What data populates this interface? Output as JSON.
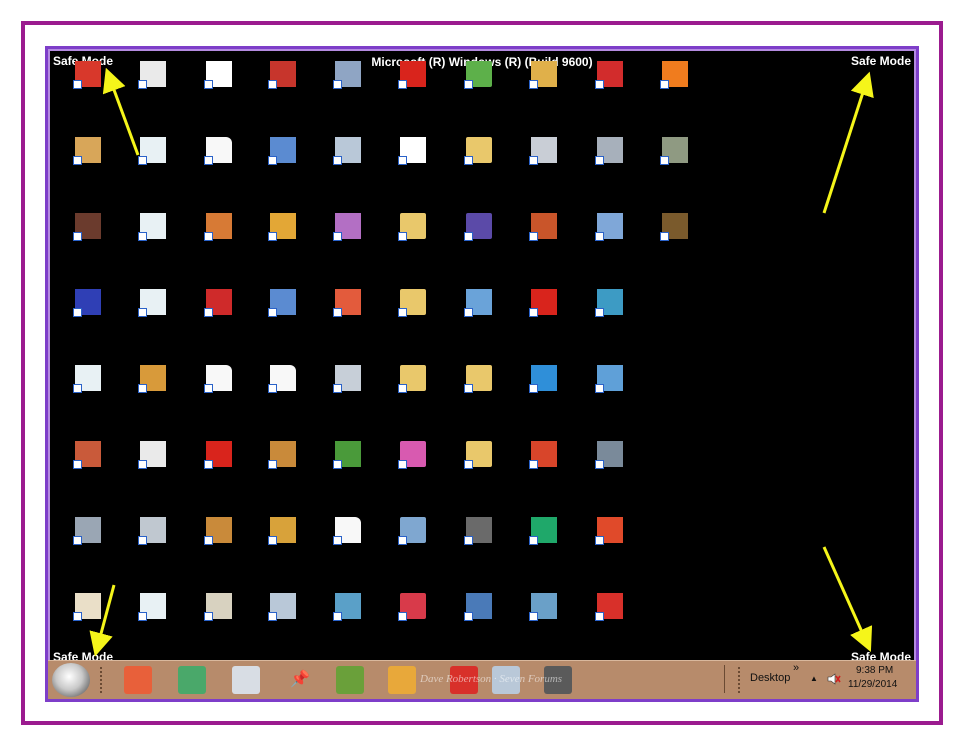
{
  "window_title": "Microsoft (R) Windows (R) (Build 9600)",
  "safe_mode_label": "Safe Mode",
  "colors": {
    "frame": "#9b1b8f",
    "screen_border": "#7e3ec9",
    "desktop": "#000000",
    "taskbar": "#b78b6b",
    "arrow": "#f5f51a"
  },
  "desktop_icons": [
    {
      "c": 0,
      "r": 0,
      "color": "#d8382b",
      "icon": "gift-icon"
    },
    {
      "c": 1,
      "r": 0,
      "color": "#eaeaea",
      "icon": "window-icon"
    },
    {
      "c": 2,
      "r": 0,
      "color": "#ffffff",
      "icon": "cursor-icon"
    },
    {
      "c": 3,
      "r": 0,
      "color": "#c7352c",
      "icon": "home-icon"
    },
    {
      "c": 4,
      "r": 0,
      "color": "#8fa5c4",
      "icon": "settings-icon"
    },
    {
      "c": 5,
      "r": 0,
      "color": "#d9241c",
      "icon": "opera-icon"
    },
    {
      "c": 6,
      "r": 0,
      "color": "#5db04a",
      "icon": "folder-icon"
    },
    {
      "c": 7,
      "r": 0,
      "color": "#e0b04a",
      "icon": "app-icon"
    },
    {
      "c": 8,
      "r": 0,
      "color": "#d22c2c",
      "icon": "app-icon"
    },
    {
      "c": 9,
      "r": 0,
      "color": "#f07c1e",
      "icon": "avast-icon"
    },
    {
      "c": 0,
      "r": 1,
      "color": "#d8a659",
      "icon": "counter-icon"
    },
    {
      "c": 1,
      "r": 1,
      "color": "#e8f1f4",
      "icon": "script-icon"
    },
    {
      "c": 2,
      "r": 1,
      "color": "#f8f8f8",
      "icon": "document-icon"
    },
    {
      "c": 3,
      "r": 1,
      "color": "#5b8bd1",
      "icon": "clock-icon"
    },
    {
      "c": 4,
      "r": 1,
      "color": "#b9c8d8",
      "icon": "settings-icon"
    },
    {
      "c": 5,
      "r": 1,
      "color": "#ffffff",
      "icon": "filezilla-icon"
    },
    {
      "c": 6,
      "r": 1,
      "color": "#e9c86b",
      "icon": "folder-icon"
    },
    {
      "c": 7,
      "r": 1,
      "color": "#c9ced6",
      "icon": "app-icon"
    },
    {
      "c": 8,
      "r": 1,
      "color": "#a7b0bb",
      "icon": "panda-icon"
    },
    {
      "c": 9,
      "r": 1,
      "color": "#8f9a82",
      "icon": "drive-icon"
    },
    {
      "c": 0,
      "r": 2,
      "color": "#6b3b2d",
      "icon": "photo-icon"
    },
    {
      "c": 1,
      "r": 2,
      "color": "#e8f1f4",
      "icon": "script-icon"
    },
    {
      "c": 2,
      "r": 2,
      "color": "#d77a35",
      "icon": "app-icon"
    },
    {
      "c": 3,
      "r": 2,
      "color": "#e3a736",
      "icon": "alarm-icon"
    },
    {
      "c": 4,
      "r": 2,
      "color": "#b36fc4",
      "icon": "app-icon"
    },
    {
      "c": 5,
      "r": 2,
      "color": "#e9c86b",
      "icon": "folder-icon"
    },
    {
      "c": 6,
      "r": 2,
      "color": "#5b4aa8",
      "icon": "folder-icon"
    },
    {
      "c": 7,
      "r": 2,
      "color": "#c9552a",
      "icon": "picture-icon"
    },
    {
      "c": 8,
      "r": 2,
      "color": "#7fa7d8",
      "icon": "app-icon"
    },
    {
      "c": 9,
      "r": 2,
      "color": "#7a5a2c",
      "icon": "toolbox-icon"
    },
    {
      "c": 0,
      "r": 3,
      "color": "#2f3fb5",
      "icon": "app-icon"
    },
    {
      "c": 1,
      "r": 3,
      "color": "#e8f1f4",
      "icon": "script-icon"
    },
    {
      "c": 2,
      "r": 3,
      "color": "#cf2a2a",
      "icon": "opera-box-icon"
    },
    {
      "c": 3,
      "r": 3,
      "color": "#5b8bd1",
      "icon": "clock-icon"
    },
    {
      "c": 4,
      "r": 3,
      "color": "#e35b3c",
      "icon": "grid-icon"
    },
    {
      "c": 5,
      "r": 3,
      "color": "#e9c86b",
      "icon": "folder-icon"
    },
    {
      "c": 6,
      "r": 3,
      "color": "#6aa3d9",
      "icon": "monitor-icon"
    },
    {
      "c": 7,
      "r": 3,
      "color": "#d9241c",
      "icon": "opera-icon"
    },
    {
      "c": 8,
      "r": 3,
      "color": "#3d9bc4",
      "icon": "help-icon"
    },
    {
      "c": 0,
      "r": 4,
      "color": "#e8f1f4",
      "icon": "script-icon"
    },
    {
      "c": 1,
      "r": 4,
      "color": "#d89a3a",
      "icon": "key-icon"
    },
    {
      "c": 2,
      "r": 4,
      "color": "#f8f8f8",
      "icon": "document-icon"
    },
    {
      "c": 3,
      "r": 4,
      "color": "#f8f8f8",
      "icon": "document-icon"
    },
    {
      "c": 4,
      "r": 4,
      "color": "#c7cfd8",
      "icon": "app-icon"
    },
    {
      "c": 5,
      "r": 4,
      "color": "#e9c86b",
      "icon": "folder-icon"
    },
    {
      "c": 6,
      "r": 4,
      "color": "#e9c86b",
      "icon": "folder-icon"
    },
    {
      "c": 7,
      "r": 4,
      "color": "#2f8fd9",
      "icon": "bird-icon"
    },
    {
      "c": 8,
      "r": 4,
      "color": "#5fa0d8",
      "icon": "picture-icon"
    },
    {
      "c": 0,
      "r": 5,
      "color": "#c95a3a",
      "icon": "app-icon"
    },
    {
      "c": 1,
      "r": 5,
      "color": "#eaeaea",
      "icon": "window-icon"
    },
    {
      "c": 2,
      "r": 5,
      "color": "#d9241c",
      "icon": "opera-icon"
    },
    {
      "c": 3,
      "r": 5,
      "color": "#c98a3a",
      "icon": "paint-icon"
    },
    {
      "c": 4,
      "r": 5,
      "color": "#4a9a3a",
      "icon": "blocks-icon"
    },
    {
      "c": 5,
      "r": 5,
      "color": "#d85ab0",
      "icon": "folder-icon"
    },
    {
      "c": 6,
      "r": 5,
      "color": "#e9c86b",
      "icon": "folder-icon"
    },
    {
      "c": 7,
      "r": 5,
      "color": "#d8452a",
      "icon": "app-icon"
    },
    {
      "c": 8,
      "r": 5,
      "color": "#7a8a9a",
      "icon": "camera-icon"
    },
    {
      "c": 0,
      "r": 6,
      "color": "#9aa6b4",
      "icon": "computer-icon"
    },
    {
      "c": 1,
      "r": 6,
      "color": "#c0c8d0",
      "icon": "app-icon"
    },
    {
      "c": 2,
      "r": 6,
      "color": "#c98a3a",
      "icon": "paint-icon"
    },
    {
      "c": 3,
      "r": 6,
      "color": "#d8a23a",
      "icon": "gear-icon"
    },
    {
      "c": 4,
      "r": 6,
      "color": "#f8f8f8",
      "icon": "document-icon"
    },
    {
      "c": 5,
      "r": 6,
      "color": "#7fa7d0",
      "icon": "folder-icon"
    },
    {
      "c": 6,
      "r": 6,
      "color": "#6a6a6a",
      "icon": "server-icon"
    },
    {
      "c": 7,
      "r": 6,
      "color": "#1fa86a",
      "icon": "chart-icon"
    },
    {
      "c": 8,
      "r": 6,
      "color": "#e04a2a",
      "icon": "chrome-icon"
    },
    {
      "c": 0,
      "r": 7,
      "color": "#eadfc8",
      "icon": "keys-icon"
    },
    {
      "c": 1,
      "r": 7,
      "color": "#e8f1f4",
      "icon": "script-icon"
    },
    {
      "c": 2,
      "r": 7,
      "color": "#d8d2c0",
      "icon": "keyboard-icon"
    },
    {
      "c": 3,
      "r": 7,
      "color": "#b9c8d8",
      "icon": "settings-icon"
    },
    {
      "c": 4,
      "r": 7,
      "color": "#5aa0c8",
      "icon": "molecule-icon"
    },
    {
      "c": 5,
      "r": 7,
      "color": "#d83a4a",
      "icon": "folder-icon"
    },
    {
      "c": 6,
      "r": 7,
      "color": "#4a7ab8",
      "icon": "shield-icon"
    },
    {
      "c": 7,
      "r": 7,
      "color": "#6aa0c8",
      "icon": "gears-icon"
    },
    {
      "c": 8,
      "r": 7,
      "color": "#d8302a",
      "icon": "ccleaner-icon"
    }
  ],
  "taskbar": {
    "pinned": [
      {
        "icon": "picture-icon",
        "color": "#e8603a"
      },
      {
        "icon": "sync-icon",
        "color": "#4aa86a"
      },
      {
        "icon": "video-icon",
        "color": "#d8dde4"
      },
      {
        "icon": "pin-icon",
        "color": "#222222"
      },
      {
        "icon": "blocks-icon",
        "color": "#6aa03a"
      },
      {
        "icon": "folder-icon",
        "color": "#e8a83a"
      },
      {
        "icon": "ccleaner-icon",
        "color": "#d8302a"
      },
      {
        "icon": "settings-icon",
        "color": "#b9c8d8"
      },
      {
        "icon": "server-icon",
        "color": "#5a5a5a"
      }
    ],
    "desktop_toolbar_label": "Desktop",
    "chevron": "»",
    "tray_up_arrow": "▲",
    "time": "9:38 PM",
    "date": "11/29/2014"
  },
  "watermark": "Dave Robertson · Seven Forums"
}
